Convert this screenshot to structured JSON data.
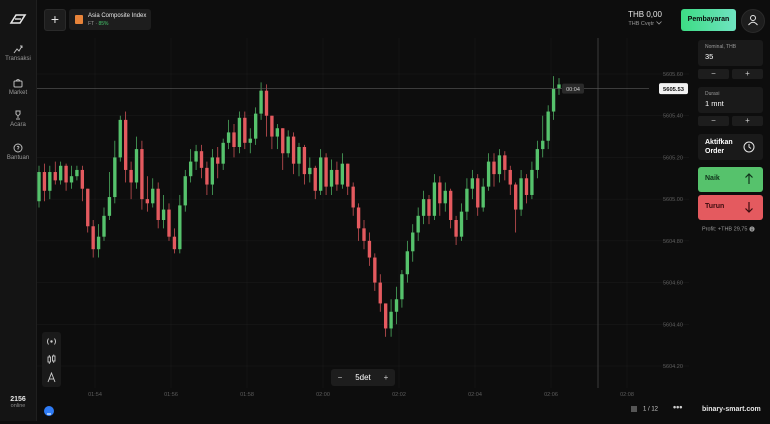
{
  "sidebar": {
    "items": [
      {
        "label": "Transaksi",
        "icon": "trade-icon"
      },
      {
        "label": "Market",
        "icon": "market-icon"
      },
      {
        "label": "Acara",
        "icon": "trophy-icon"
      },
      {
        "label": "Bantuan",
        "icon": "help-icon"
      }
    ],
    "online_count": "2156",
    "online_label": "online"
  },
  "header": {
    "asset_name": "Asia Composite Index",
    "asset_type": "FT",
    "asset_payout": "85%",
    "balance": "THB 0,00",
    "account": "THB Cvętr",
    "pay_label": "Pembayaran"
  },
  "chart_data": {
    "type": "candlestick",
    "current_price": "5605.53",
    "countdown": "00:04",
    "y_ticks": [
      "5605.60",
      "5605.40",
      "5605.20",
      "5605.00",
      "5604.80",
      "5604.60",
      "5604.40",
      "5604.20"
    ],
    "x_ticks": [
      "01:54",
      "01:56",
      "01:58",
      "02:00",
      "02:02",
      "02:04",
      "02:06",
      "02:08"
    ],
    "candles": [
      [
        5604.99,
        5605.13,
        5605.16,
        5604.96
      ],
      [
        5605.13,
        5605.04,
        5605.17,
        5604.99
      ],
      [
        5605.04,
        5605.13,
        5605.16,
        5605.0
      ],
      [
        5605.13,
        5605.09,
        5605.18,
        5605.07
      ],
      [
        5605.09,
        5605.16,
        5605.18,
        5605.07
      ],
      [
        5605.16,
        5605.08,
        5605.17,
        5605.04
      ],
      [
        5605.08,
        5605.11,
        5605.16,
        5605.05
      ],
      [
        5605.11,
        5605.14,
        5605.16,
        5605.09
      ],
      [
        5605.14,
        5605.05,
        5605.16,
        5604.99
      ],
      [
        5605.05,
        5604.87,
        5605.05,
        5604.84
      ],
      [
        5604.87,
        5604.76,
        5604.9,
        5604.72
      ],
      [
        5604.76,
        5604.82,
        5604.88,
        5604.72
      ],
      [
        5604.82,
        5604.92,
        5604.96,
        5604.8
      ],
      [
        5604.92,
        5605.01,
        5605.13,
        5604.9
      ],
      [
        5605.01,
        5605.2,
        5605.28,
        5604.98
      ],
      [
        5605.2,
        5605.38,
        5605.4,
        5605.18
      ],
      [
        5605.38,
        5605.14,
        5605.42,
        5605.08
      ],
      [
        5605.14,
        5605.08,
        5605.18,
        5605.0
      ],
      [
        5605.08,
        5605.24,
        5605.3,
        5605.05
      ],
      [
        5605.24,
        5605.0,
        5605.28,
        5604.95
      ],
      [
        5605.0,
        5604.98,
        5605.11,
        5604.94
      ],
      [
        5604.98,
        5605.05,
        5605.1,
        5604.96
      ],
      [
        5605.05,
        5604.9,
        5605.08,
        5604.86
      ],
      [
        5604.9,
        5604.95,
        5605.02,
        5604.86
      ],
      [
        5604.95,
        5604.82,
        5604.98,
        5604.8
      ],
      [
        5604.82,
        5604.76,
        5604.86,
        5604.74
      ],
      [
        5604.76,
        5604.97,
        5605.02,
        5604.74
      ],
      [
        5604.97,
        5605.11,
        5605.14,
        5604.94
      ],
      [
        5605.11,
        5605.18,
        5605.24,
        5605.08
      ],
      [
        5605.18,
        5605.23,
        5605.26,
        5605.14
      ],
      [
        5605.23,
        5605.15,
        5605.26,
        5605.1
      ],
      [
        5605.15,
        5605.07,
        5605.18,
        5605.02
      ],
      [
        5605.07,
        5605.2,
        5605.24,
        5605.02
      ],
      [
        5605.2,
        5605.17,
        5605.25,
        5605.1
      ],
      [
        5605.17,
        5605.27,
        5605.29,
        5605.14
      ],
      [
        5605.27,
        5605.32,
        5605.38,
        5605.24
      ],
      [
        5605.32,
        5605.25,
        5605.36,
        5605.2
      ],
      [
        5605.25,
        5605.39,
        5605.42,
        5605.22
      ],
      [
        5605.39,
        5605.27,
        5605.42,
        5605.24
      ],
      [
        5605.27,
        5605.29,
        5605.34,
        5605.22
      ],
      [
        5605.29,
        5605.41,
        5605.44,
        5605.26
      ],
      [
        5605.41,
        5605.52,
        5605.56,
        5605.38
      ],
      [
        5605.52,
        5605.4,
        5605.55,
        5605.3
      ],
      [
        5605.4,
        5605.3,
        5605.4,
        5605.24
      ],
      [
        5605.3,
        5605.34,
        5605.36,
        5605.24
      ],
      [
        5605.34,
        5605.22,
        5605.34,
        5605.14
      ],
      [
        5605.22,
        5605.3,
        5605.33,
        5605.2
      ],
      [
        5605.3,
        5605.17,
        5605.32,
        5605.12
      ],
      [
        5605.17,
        5605.25,
        5605.27,
        5605.11
      ],
      [
        5605.25,
        5605.12,
        5605.26,
        5605.07
      ],
      [
        5605.12,
        5605.15,
        5605.2,
        5605.08
      ],
      [
        5605.15,
        5605.04,
        5605.16,
        5605.0
      ],
      [
        5605.04,
        5605.2,
        5605.24,
        5605.02
      ],
      [
        5605.2,
        5605.06,
        5605.22,
        5605.02
      ],
      [
        5605.06,
        5605.14,
        5605.19,
        5605.02
      ],
      [
        5605.14,
        5605.07,
        5605.18,
        5605.04
      ],
      [
        5605.07,
        5605.17,
        5605.22,
        5605.05
      ],
      [
        5605.17,
        5605.06,
        5605.17,
        5605.02
      ],
      [
        5605.06,
        5604.96,
        5605.08,
        5604.92
      ],
      [
        5604.96,
        5604.86,
        5604.98,
        5604.8
      ],
      [
        5604.86,
        5604.8,
        5604.9,
        5604.76
      ],
      [
        5604.8,
        5604.72,
        5604.84,
        5604.68
      ],
      [
        5604.72,
        5604.6,
        5604.74,
        5604.56
      ],
      [
        5604.6,
        5604.5,
        5604.64,
        5604.46
      ],
      [
        5604.5,
        5604.38,
        5604.5,
        5604.34
      ],
      [
        5604.38,
        5604.46,
        5604.52,
        5604.34
      ],
      [
        5604.46,
        5604.52,
        5604.58,
        5604.4
      ],
      [
        5604.52,
        5604.64,
        5604.66,
        5604.48
      ],
      [
        5604.64,
        5604.75,
        5604.8,
        5604.6
      ],
      [
        5604.75,
        5604.84,
        5604.88,
        5604.7
      ],
      [
        5604.84,
        5604.92,
        5604.96,
        5604.8
      ],
      [
        5604.92,
        5605.0,
        5605.04,
        5604.88
      ],
      [
        5605.0,
        5604.92,
        5605.02,
        5604.88
      ],
      [
        5604.92,
        5605.08,
        5605.12,
        5604.9
      ],
      [
        5605.08,
        5604.98,
        5605.11,
        5604.92
      ],
      [
        5604.98,
        5605.04,
        5605.08,
        5604.94
      ],
      [
        5605.04,
        5604.9,
        5605.05,
        5604.86
      ],
      [
        5604.9,
        5604.82,
        5604.92,
        5604.78
      ],
      [
        5604.82,
        5604.94,
        5604.98,
        5604.8
      ],
      [
        5604.94,
        5605.05,
        5605.1,
        5604.9
      ],
      [
        5605.05,
        5605.1,
        5605.14,
        5605.0
      ],
      [
        5605.1,
        5604.96,
        5605.12,
        5604.92
      ],
      [
        5604.96,
        5605.06,
        5605.1,
        5604.94
      ],
      [
        5605.06,
        5605.18,
        5605.22,
        5605.04
      ],
      [
        5605.18,
        5605.12,
        5605.22,
        5605.06
      ],
      [
        5605.12,
        5605.21,
        5605.24,
        5605.08
      ],
      [
        5605.21,
        5605.14,
        5605.23,
        5605.09
      ],
      [
        5605.14,
        5605.07,
        5605.16,
        5605.02
      ],
      [
        5605.07,
        5604.95,
        5605.08,
        5604.84
      ],
      [
        5604.95,
        5605.1,
        5605.14,
        5604.92
      ],
      [
        5605.1,
        5605.02,
        5605.12,
        5604.98
      ],
      [
        5605.02,
        5605.14,
        5605.18,
        5605.0
      ],
      [
        5605.14,
        5605.24,
        5605.28,
        5605.1
      ],
      [
        5605.24,
        5605.28,
        5605.4,
        5605.2
      ],
      [
        5605.28,
        5605.42,
        5605.45,
        5605.24
      ],
      [
        5605.42,
        5605.53,
        5605.59,
        5605.38
      ],
      [
        5605.53,
        5605.55,
        5605.58,
        5605.5
      ]
    ]
  },
  "tools": [
    {
      "icon": "signal-icon"
    },
    {
      "icon": "candles-icon"
    },
    {
      "icon": "drawing-icon"
    }
  ],
  "zoom": {
    "minus": "−",
    "value": "5det",
    "plus": "+"
  },
  "panel": {
    "amount_label": "Nominal, THB",
    "amount_value": "35",
    "duration_label": "Durasi",
    "duration_value": "1 mnt",
    "minus": "−",
    "plus": "+",
    "order_label": "Aktifkan Order",
    "up_label": "Naik",
    "down_label": "Turun",
    "profit_text": "Profit: +THB 29,75"
  },
  "footer": {
    "pager": "1 / 12",
    "more": "•••",
    "brand": "binary-smart.com"
  },
  "colors": {
    "up": "#56c26c",
    "down": "#e45a5f",
    "accent": "#3ddc84"
  }
}
